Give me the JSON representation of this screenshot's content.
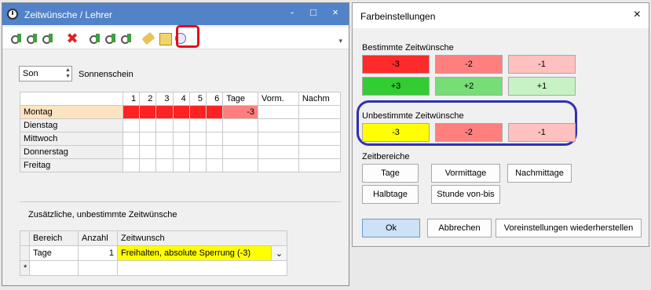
{
  "left_window": {
    "title": "Zeitwünsche / Lehrer",
    "caption_buttons": {
      "minimize": "-",
      "maximize": "□",
      "close": "×"
    },
    "toolbar_icons": [
      "key-green-icon",
      "key-green-icon",
      "key-green-icon",
      "delete-x-icon",
      "key-grid-icon",
      "key-grid-icon",
      "key-grid-icon",
      "pencil-icon",
      "ruler-icon",
      "copy-icon"
    ],
    "combo": {
      "value": "Son",
      "label": "Sonnenschein"
    },
    "grid": {
      "headers": [
        "",
        "1",
        "2",
        "3",
        "4",
        "5",
        "6",
        "Tage",
        "Vorm.",
        "Nachm"
      ],
      "rows": [
        {
          "day": "Montag",
          "tage": "-3"
        },
        {
          "day": "Dienstag",
          "tage": ""
        },
        {
          "day": "Mittwoch",
          "tage": ""
        },
        {
          "day": "Donnerstag",
          "tage": ""
        },
        {
          "day": "Freitag",
          "tage": ""
        }
      ]
    },
    "zusatz_label": "Zusätzliche, unbestimmte Zeitwünsche",
    "zusatz_grid": {
      "headers": [
        "Bereich",
        "Anzahl",
        "Zeitwunsch"
      ],
      "row": {
        "bereich": "Tage",
        "anzahl": "1",
        "zeitwunsch": "Freihalten, absolute Sperrung (-3)"
      },
      "new_row_marker": "*"
    }
  },
  "right_dialog": {
    "title": "Farbeinstellungen",
    "close": "×",
    "bestimmte_label": "Bestimmte Zeitwünsche",
    "bestimmte": [
      {
        "label": "-3",
        "color": "#ff2a2a"
      },
      {
        "label": "-2",
        "color": "#ff7f7f"
      },
      {
        "label": "-1",
        "color": "#ffc0c0"
      },
      {
        "label": "+3",
        "color": "#33cc33"
      },
      {
        "label": "+2",
        "color": "#77dd77"
      },
      {
        "label": "+1",
        "color": "#c6f2c6"
      }
    ],
    "unbestimmte_label": "Unbestimmte Zeitwünsche",
    "unbestimmte": [
      {
        "label": "-3",
        "color": "#ffff00"
      },
      {
        "label": "-2",
        "color": "#ff7f7f"
      },
      {
        "label": "-1",
        "color": "#ffc0c0"
      }
    ],
    "zeitbereiche_label": "Zeitbereiche",
    "zeit_buttons": [
      "Tage",
      "Vormittage",
      "Nachmittage",
      "Halbtage",
      "Stunde von-bis"
    ],
    "footer": {
      "ok": "Ok",
      "cancel": "Abbrechen",
      "reset": "Voreinstellungen wiederherstellen"
    }
  }
}
